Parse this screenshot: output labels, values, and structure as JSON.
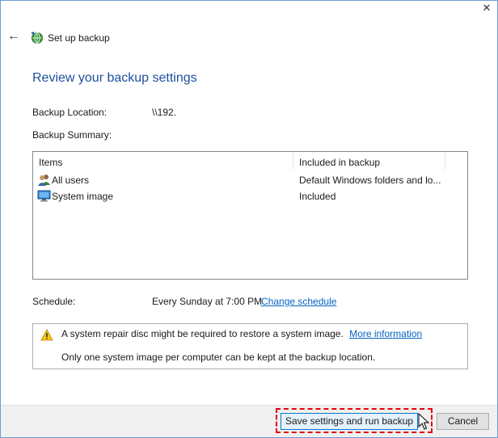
{
  "window": {
    "close_glyph": "✕",
    "back_glyph": "←",
    "title": "Set up backup"
  },
  "main": {
    "heading": "Review your backup settings",
    "backup_location_label": "Backup Location:",
    "backup_location_value": "\\\\192.",
    "backup_summary_label": "Backup Summary:",
    "table": {
      "columns": [
        "Items",
        "Included in backup"
      ],
      "rows": [
        {
          "icon": "users-icon",
          "name": "All users",
          "included": "Default Windows folders and lo..."
        },
        {
          "icon": "monitor-icon",
          "name": "System image",
          "included": "Included"
        }
      ]
    },
    "schedule_label": "Schedule:",
    "schedule_value": "Every Sunday at 7:00 PM",
    "change_schedule_link": "Change schedule",
    "info": {
      "icon": "warning-icon",
      "line1": "A system repair disc might be required to restore a system image.",
      "more_info_link": "More information",
      "line2": "Only one system image per computer can be kept at the backup location."
    }
  },
  "footer": {
    "save_button": "Save settings and run backup",
    "cancel_button": "Cancel"
  },
  "colors": {
    "heading": "#1e4e9c",
    "link": "#0563c1",
    "highlight": "#e8000d",
    "warning": "#f5c518"
  }
}
